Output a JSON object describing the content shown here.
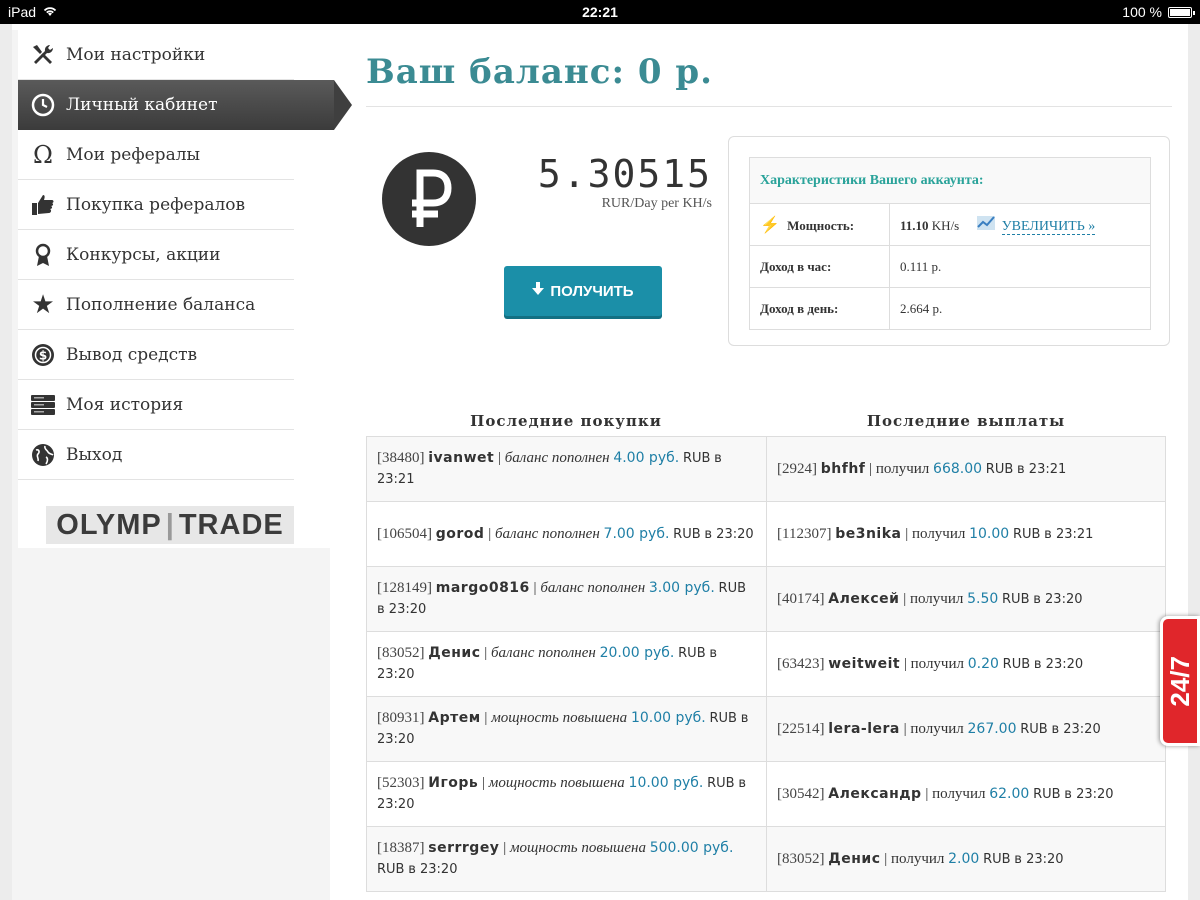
{
  "status_bar": {
    "device": "iPad",
    "time": "22:21",
    "battery": "100 %"
  },
  "sidebar": {
    "items": [
      {
        "label": "Мои настройки",
        "icon": "tools-icon"
      },
      {
        "label": "Личный кабинет",
        "icon": "clock-icon",
        "active": true
      },
      {
        "label": "Мои рефералы",
        "icon": "omega-icon"
      },
      {
        "label": "Покупка рефералов",
        "icon": "thumbs-up-icon"
      },
      {
        "label": "Конкурсы, акции",
        "icon": "award-icon"
      },
      {
        "label": "Пополнение баланса",
        "icon": "star-icon"
      },
      {
        "label": "Вывод средств",
        "icon": "coin-icon"
      },
      {
        "label": "Моя история",
        "icon": "server-icon"
      },
      {
        "label": "Выход",
        "icon": "globe-icon"
      }
    ],
    "logo": {
      "left": "OLYMP",
      "right": "TRADE"
    }
  },
  "main": {
    "balance_title": "Ваш баланс: 0 р.",
    "rate_value": "5.30515",
    "rate_unit": "RUR/Day per KH/s",
    "get_button": "ПОЛУЧИТЬ",
    "account": {
      "heading": "Характеристики Вашего аккаунта:",
      "power_label": "Мощность:",
      "power_value": "11.10",
      "power_unit": "KH/s",
      "upgrade_link": "УВЕЛИЧИТЬ »",
      "hour_label": "Доход в час:",
      "hour_value": "0.111 р.",
      "day_label": "Доход в день:",
      "day_value": "2.664 р."
    },
    "purchases_heading": "Последние покупки",
    "payouts_heading": "Последние выплаты",
    "purchases": [
      {
        "id": "[38480]",
        "name": "ivanwet",
        "action": "баланс пополнен",
        "amount": "4.00 руб.",
        "currency": "RUB",
        "time": "в 23:21"
      },
      {
        "id": "[106504]",
        "name": "gorod",
        "action": "баланс пополнен",
        "amount": "7.00 руб.",
        "currency": "RUB",
        "time": "в 23:20"
      },
      {
        "id": "[128149]",
        "name": "margo0816",
        "action": "баланс пополнен",
        "amount": "3.00 руб.",
        "currency": "RUB",
        "time": "в 23:20"
      },
      {
        "id": "[83052]",
        "name": "Денис",
        "action": "баланс пополнен",
        "amount": "20.00 руб.",
        "currency": "RUB",
        "time": "в 23:20"
      },
      {
        "id": "[80931]",
        "name": "Артем",
        "action": "мощность повышена",
        "amount": "10.00 руб.",
        "currency": "RUB",
        "time": "в 23:20"
      },
      {
        "id": "[52303]",
        "name": "Игорь",
        "action": "мощность повышена",
        "amount": "10.00 руб.",
        "currency": "RUB",
        "time": "в 23:20"
      },
      {
        "id": "[18387]",
        "name": "serrrgey",
        "action": "мощность повышена",
        "amount": "500.00 руб.",
        "currency": "RUB",
        "time": "в 23:20"
      }
    ],
    "payouts": [
      {
        "id": "[2924]",
        "name": "bhfhf",
        "verb": "получил",
        "amount": "668.00",
        "currency": "RUB",
        "time": "в 23:21"
      },
      {
        "id": "[112307]",
        "name": "be3nika",
        "verb": "получил",
        "amount": "10.00",
        "currency": "RUB",
        "time": "в 23:21"
      },
      {
        "id": "[40174]",
        "name": "Алексей",
        "verb": "получил",
        "amount": "5.50",
        "currency": "RUB",
        "time": "в 23:20"
      },
      {
        "id": "[63423]",
        "name": "weitweit",
        "verb": "получил",
        "amount": "0.20",
        "currency": "RUB",
        "time": "в 23:20"
      },
      {
        "id": "[22514]",
        "name": "lera-lera",
        "verb": "получил",
        "amount": "267.00",
        "currency": "RUB",
        "time": "в 23:20"
      },
      {
        "id": "[30542]",
        "name": "Александр",
        "verb": "получил",
        "amount": "62.00",
        "currency": "RUB",
        "time": "в 23:20"
      },
      {
        "id": "[83052]",
        "name": "Денис",
        "verb": "получил",
        "amount": "2.00",
        "currency": "RUB",
        "time": "в 23:20"
      }
    ]
  },
  "support_badge": {
    "text": "24/7"
  },
  "colors": {
    "accent": "#3b8b93",
    "button": "#1b8fa8",
    "link": "#1f7fa6",
    "badge": "#e0262b"
  }
}
